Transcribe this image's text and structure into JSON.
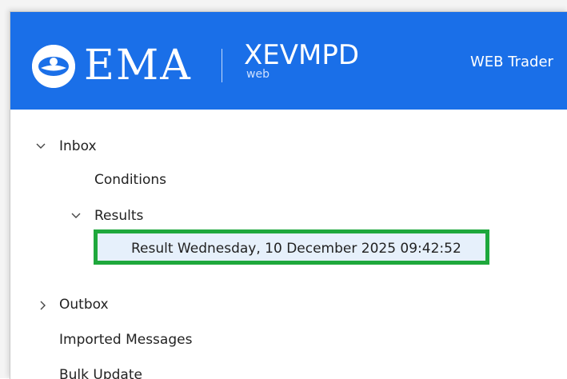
{
  "header": {
    "brand": "EMA",
    "product": "XEVMPD",
    "product_sub": "web",
    "app_title": "WEB Trader",
    "logo_icon": "ema-logo-icon",
    "background_color": "#1a6fe8"
  },
  "tree": {
    "inbox": {
      "label": "Inbox",
      "expanded": true,
      "icon": "chevron-down-icon",
      "children": {
        "conditions": {
          "label": "Conditions"
        },
        "results": {
          "label": "Results",
          "expanded": true,
          "icon": "chevron-down-icon",
          "children": [
            {
              "label": "Result Wednesday, 10 December 2025 09:42:52",
              "selected": true,
              "highlight_color": "#1ea83c"
            }
          ]
        }
      }
    },
    "outbox": {
      "label": "Outbox",
      "expanded": false,
      "icon": "chevron-right-icon"
    },
    "imported": {
      "label": "Imported Messages"
    },
    "bulk": {
      "label": "Bulk Update"
    }
  }
}
